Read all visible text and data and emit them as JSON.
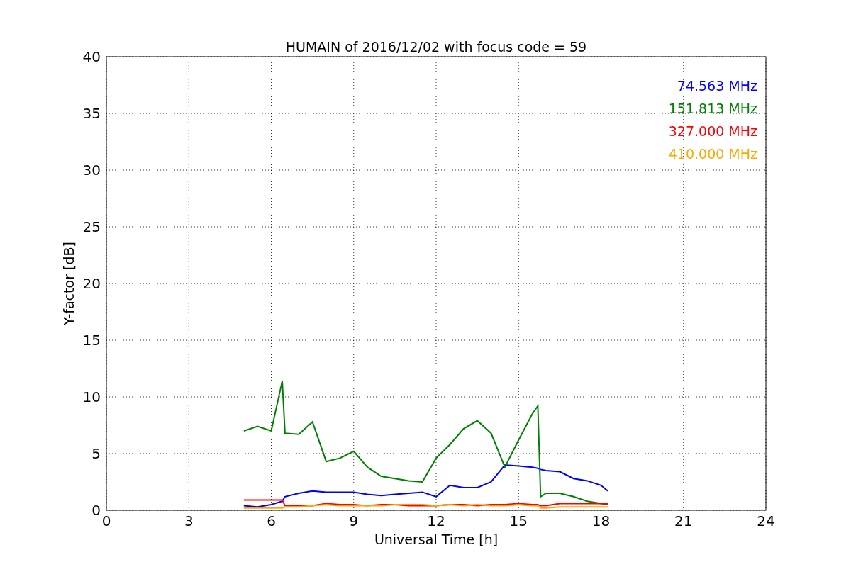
{
  "chart_data": {
    "type": "line",
    "title": "HUMAIN of 2016/12/02 with focus code = 59",
    "xlabel": "Universal Time [h]",
    "ylabel": "Y-factor [dB]",
    "x": [
      5,
      5.5,
      6,
      6.4,
      6.5,
      7,
      7.5,
      8,
      8.5,
      9,
      9.5,
      10,
      10.5,
      11,
      11.5,
      12,
      12.5,
      13,
      13.5,
      14,
      14.5,
      15,
      15.5,
      15.7,
      15.8,
      16,
      16.5,
      17,
      17.5,
      18,
      18.25
    ],
    "series": [
      {
        "name": "74.563 MHz",
        "color": "#0000ff",
        "values": [
          0.4,
          0.3,
          0.5,
          0.8,
          1.2,
          1.5,
          1.7,
          1.6,
          1.6,
          1.6,
          1.4,
          1.3,
          1.4,
          1.5,
          1.6,
          1.2,
          2.2,
          2.0,
          2.0,
          2.5,
          4.0,
          3.9,
          3.8,
          3.7,
          3.6,
          3.5,
          3.4,
          2.8,
          2.6,
          2.2,
          1.7
        ]
      },
      {
        "name": "151.813 MHz",
        "color": "#008000",
        "values": [
          7.0,
          7.4,
          7.0,
          11.4,
          6.8,
          6.7,
          7.8,
          4.3,
          4.6,
          5.2,
          3.8,
          3.0,
          2.8,
          2.6,
          2.5,
          4.6,
          5.8,
          7.2,
          7.9,
          6.8,
          3.8,
          6.2,
          8.5,
          9.2,
          1.2,
          1.5,
          1.5,
          1.2,
          0.8,
          0.6,
          0.5
        ]
      },
      {
        "name": "327.000 MHz",
        "color": "#ff0000",
        "values": [
          0.9,
          0.9,
          0.9,
          0.9,
          0.4,
          0.4,
          0.4,
          0.6,
          0.5,
          0.5,
          0.4,
          0.5,
          0.5,
          0.4,
          0.4,
          0.4,
          0.5,
          0.5,
          0.4,
          0.5,
          0.5,
          0.6,
          0.5,
          0.5,
          0.4,
          0.4,
          0.6,
          0.6,
          0.6,
          0.6,
          0.6
        ]
      },
      {
        "name": "410.000 MHz",
        "color": "#ffa500",
        "values": [
          0.2,
          0.2,
          0.2,
          0.2,
          0.3,
          0.3,
          0.4,
          0.5,
          0.4,
          0.4,
          0.4,
          0.4,
          0.5,
          0.5,
          0.5,
          0.4,
          0.5,
          0.4,
          0.5,
          0.4,
          0.4,
          0.5,
          0.4,
          0.4,
          0.2,
          0.2,
          0.3,
          0.3,
          0.3,
          0.3,
          0.3
        ]
      }
    ],
    "xlim": [
      0,
      24
    ],
    "ylim": [
      0,
      40
    ],
    "xticks": [
      0,
      3,
      6,
      9,
      12,
      15,
      18,
      21,
      24
    ],
    "yticks": [
      0,
      5,
      10,
      15,
      20,
      25,
      30,
      35,
      40
    ],
    "grid": true
  }
}
